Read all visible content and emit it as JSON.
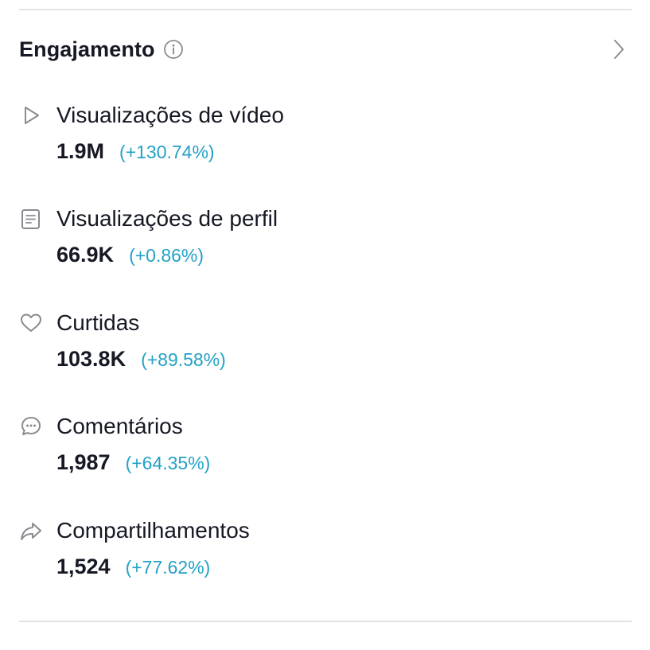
{
  "header": {
    "title": "Engajamento",
    "info_icon": "info-icon",
    "chevron_icon": "chevron-right-icon"
  },
  "colors": {
    "text": "#161823",
    "change_positive": "#23a1c6",
    "icon": "#8a8b91",
    "divider": "#e3e3e4"
  },
  "metrics": [
    {
      "icon": "play-icon",
      "label": "Visualizações de vídeo",
      "value": "1.9M",
      "change": "(+130.74%)"
    },
    {
      "icon": "profile-icon",
      "label": "Visualizações de perfil",
      "value": "66.9K",
      "change": "(+0.86%)"
    },
    {
      "icon": "heart-icon",
      "label": "Curtidas",
      "value": "103.8K",
      "change": "(+89.58%)"
    },
    {
      "icon": "comment-icon",
      "label": "Comentários",
      "value": "1,987",
      "change": "(+64.35%)"
    },
    {
      "icon": "share-icon",
      "label": "Compartilhamentos",
      "value": "1,524",
      "change": "(+77.62%)"
    }
  ]
}
